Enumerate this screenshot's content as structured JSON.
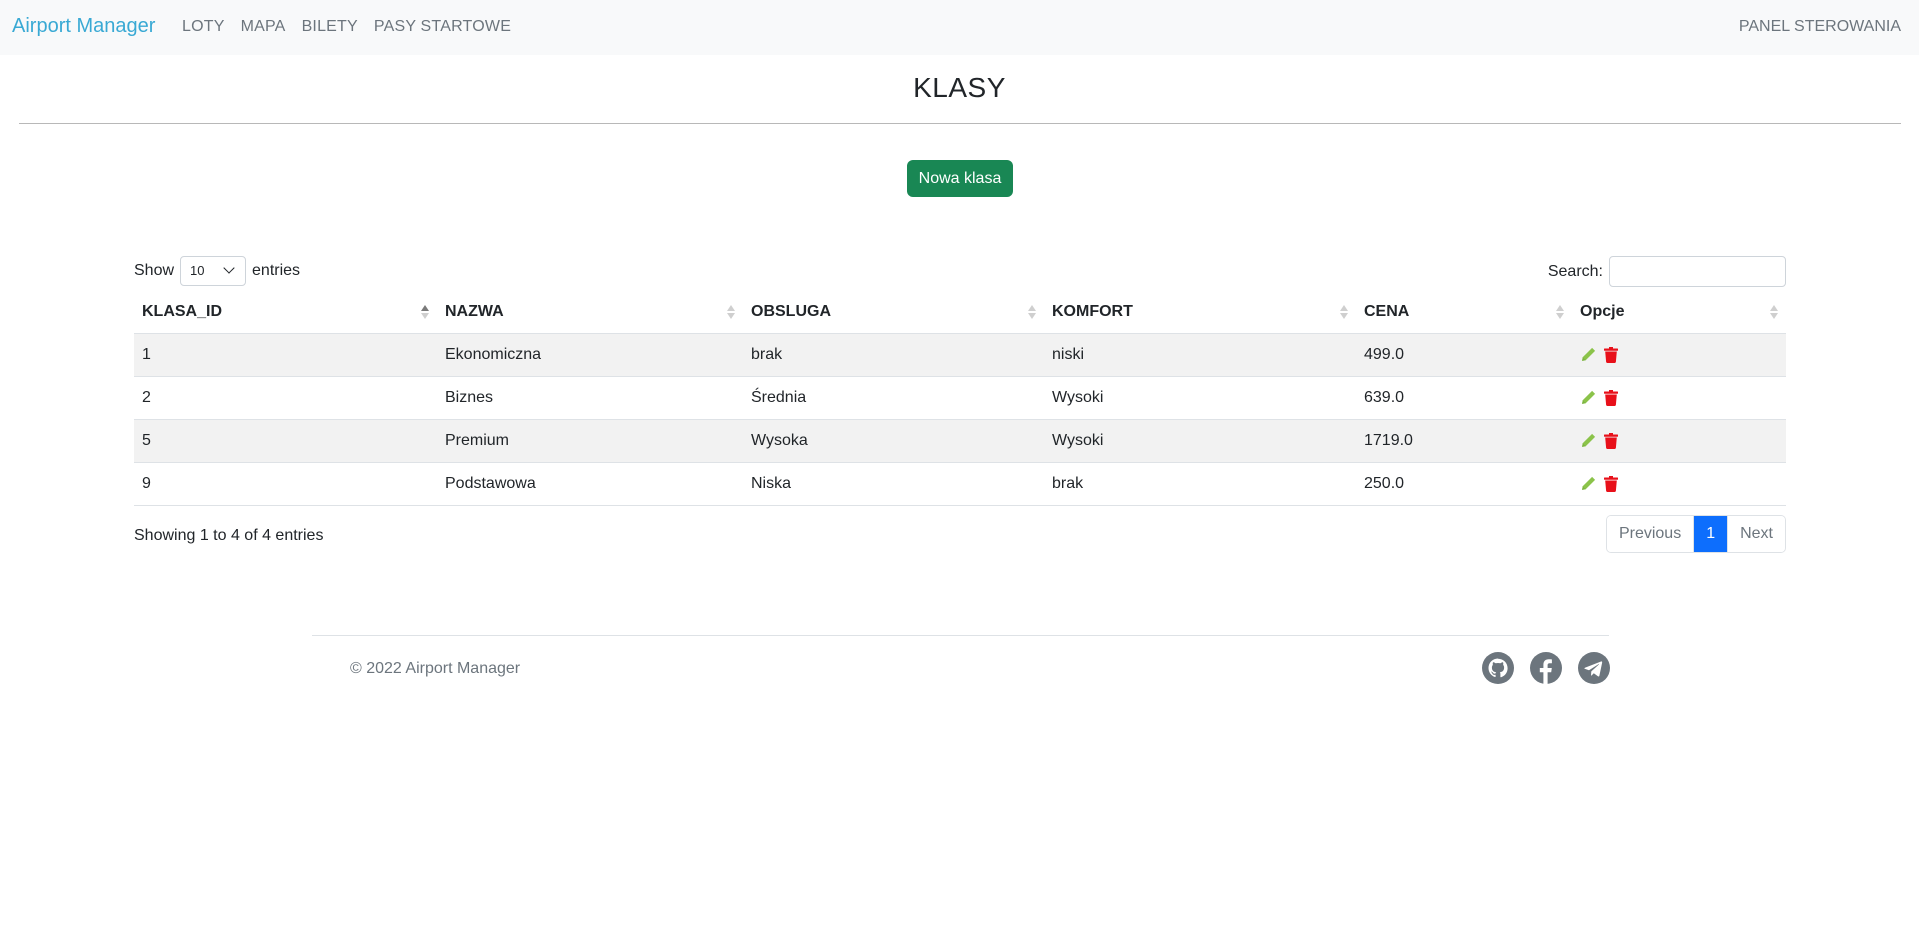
{
  "navbar": {
    "brand": "Airport Manager",
    "links": [
      "LOTY",
      "MAPA",
      "BILETY",
      "PASY STARTOWE"
    ],
    "right_link": "PANEL STEROWANIA"
  },
  "page": {
    "title": "KLASY",
    "new_button": "Nowa klasa"
  },
  "table_controls": {
    "show_label": "Show",
    "entries_value": "10",
    "entries_label": "entries",
    "search_label": "Search:",
    "search_value": ""
  },
  "table": {
    "headers": [
      "KLASA_ID",
      "NAZWA",
      "OBSLUGA",
      "KOMFORT",
      "CENA",
      "Opcje"
    ],
    "rows": [
      [
        "1",
        "Ekonomiczna",
        "brak",
        "niski",
        "499.0"
      ],
      [
        "2",
        "Biznes",
        "Średnia",
        "Wysoki",
        "639.0"
      ],
      [
        "5",
        "Premium",
        "Wysoka",
        "Wysoki",
        "1719.0"
      ],
      [
        "9",
        "Podstawowa",
        "Niska",
        "brak",
        "250.0"
      ]
    ]
  },
  "footer_table": {
    "info": "Showing 1 to 4 of 4 entries",
    "prev": "Previous",
    "page": "1",
    "next": "Next"
  },
  "footer": {
    "copyright": "© 2022 Airport Manager",
    "icons": [
      "github-icon",
      "facebook-icon",
      "telegram-icon"
    ]
  },
  "colors": {
    "brand": "#39a9d4",
    "new_button": "#198754",
    "edit_icon": "#8bc34a",
    "delete_icon": "#e8101a",
    "page_active": "#0d6efd",
    "social": "#6c757d"
  }
}
